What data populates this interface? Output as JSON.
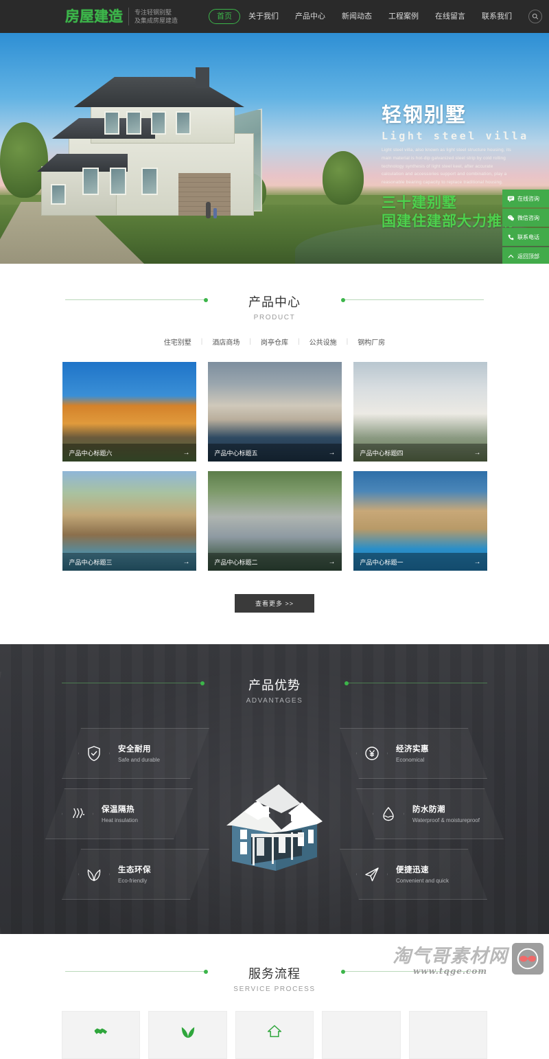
{
  "header": {
    "logo_text": "房屋建造",
    "logo_tagline_line1": "专注轻钢别墅",
    "logo_tagline_line2": "及集成房屋建造",
    "search_icon": "search-icon",
    "nav": [
      {
        "label": "首页",
        "active": true
      },
      {
        "label": "关于我们",
        "active": false
      },
      {
        "label": "产品中心",
        "active": false
      },
      {
        "label": "新闻动态",
        "active": false
      },
      {
        "label": "工程案例",
        "active": false
      },
      {
        "label": "在线留言",
        "active": false
      },
      {
        "label": "联系我们",
        "active": false
      }
    ]
  },
  "hero": {
    "title_cn": "轻钢别墅",
    "title_en": "Light steel villa",
    "paragraph": "Light steel villa, also known as light steel structure housing, its main material is hot-dip galvanized steel strip by cold rolling technology synthesis of light steel keel, after accurate calculation and accessories support and combination, play a reasonable bearing capacity to replace traditional housing.",
    "slogan_line1": "三十建别墅",
    "slogan_line2": "国建住建部大力推荐"
  },
  "side_panel": [
    {
      "label": "在线咨询",
      "icon": "chat-icon"
    },
    {
      "label": "微信咨询",
      "icon": "wechat-icon"
    },
    {
      "label": "联系电话",
      "icon": "phone-icon"
    },
    {
      "label": "返回顶部",
      "icon": "chevron-up-icon"
    }
  ],
  "product": {
    "title_cn": "产品中心",
    "title_en": "PRODUCT",
    "tabs": [
      "住宅别墅",
      "酒店商场",
      "岗亭仓库",
      "公共设施",
      "钢构厂房"
    ],
    "items": [
      {
        "title": "产品中心标题六",
        "arrow": "→"
      },
      {
        "title": "产品中心标题五",
        "arrow": "→"
      },
      {
        "title": "产品中心标题四",
        "arrow": "→"
      },
      {
        "title": "产品中心标题三",
        "arrow": "→"
      },
      {
        "title": "产品中心标题二",
        "arrow": "→"
      },
      {
        "title": "产品中心标题一",
        "arrow": "→"
      }
    ],
    "more_label": "查看更多 >>"
  },
  "advantages": {
    "title_cn": "产品优势",
    "title_en": "ADVANTAGES",
    "left": [
      {
        "cn": "安全耐用",
        "en": "Safe and durable",
        "icon": "shield-check-icon"
      },
      {
        "cn": "保温隔热",
        "en": "Heat insulation",
        "icon": "heat-waves-icon"
      },
      {
        "cn": "生态环保",
        "en": "Eco-friendly",
        "icon": "leaf-icon"
      }
    ],
    "right": [
      {
        "cn": "经济实惠",
        "en": "Economical",
        "icon": "yuan-coin-icon"
      },
      {
        "cn": "防水防潮",
        "en": "Waterproof & moistureproof",
        "icon": "water-drop-icon"
      },
      {
        "cn": "便捷迅速",
        "en": "Convenient and quick",
        "icon": "paper-plane-icon"
      }
    ]
  },
  "service": {
    "title_cn": "服务流程",
    "title_en": "SERVICE PROCESS",
    "steps": [
      {
        "icon": "handshake-icon"
      },
      {
        "icon": "leaf-icon"
      },
      {
        "icon": "home-icon"
      },
      {
        "icon": "blank-icon"
      },
      {
        "icon": "blank-icon"
      }
    ]
  },
  "watermark": {
    "name_cn": "淘气哥素材网",
    "url": "www.tqge.com",
    "logo_icon": "glasses-face-icon"
  },
  "colors": {
    "brand_green": "#3cb54a",
    "header_dark": "#2a2a2a",
    "panel_green": "#42ab4a",
    "advantages_bg": "#35363a",
    "slogan_green": "#4dd14d"
  }
}
